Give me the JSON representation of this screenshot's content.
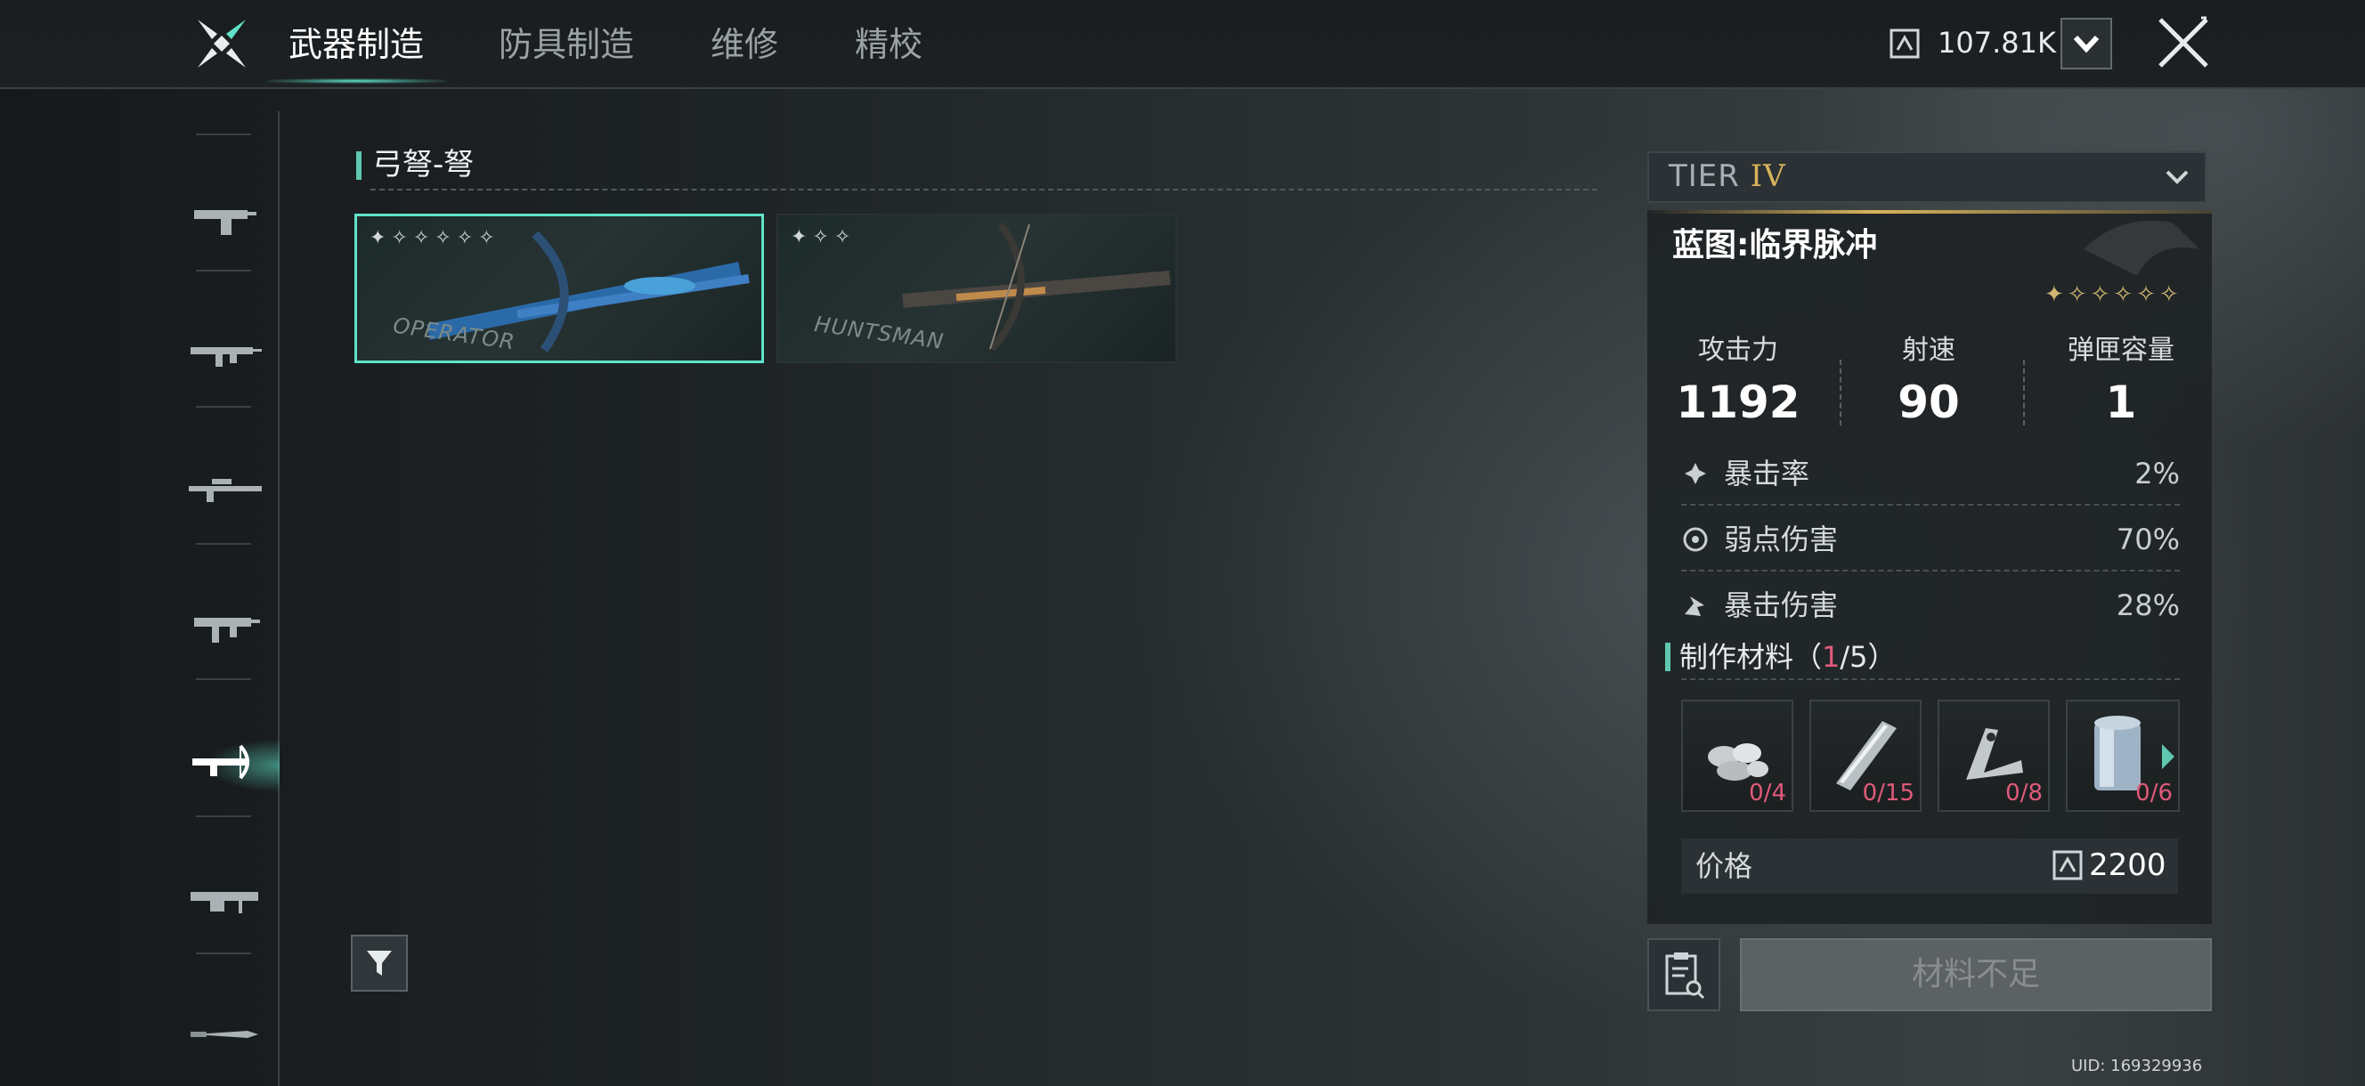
{
  "header": {
    "tabs": [
      {
        "label": "武器制造"
      },
      {
        "label": "防具制造"
      },
      {
        "label": "维修"
      },
      {
        "label": "精校"
      }
    ],
    "currency_amount": "107.81K"
  },
  "sidebar": {
    "categories": [
      {
        "icon": "pistol-icon"
      },
      {
        "icon": "assault-rifle-icon"
      },
      {
        "icon": "sniper-rifle-icon"
      },
      {
        "icon": "smg-icon"
      },
      {
        "icon": "crossbow-icon",
        "active": true
      },
      {
        "icon": "machine-gun-icon"
      },
      {
        "icon": "melee-knife-icon"
      }
    ]
  },
  "catalog": {
    "category_title": "弓弩-弩",
    "items": [
      {
        "name": "OPERATOR",
        "stars": "✦✧✧✧✧✧",
        "selected": true
      },
      {
        "name": "HUNTSMAN",
        "stars": "✦✧✧",
        "selected": false
      }
    ]
  },
  "panel": {
    "tier_label": "TIER",
    "tier_num": "IV",
    "blueprint_name": "蓝图:临界脉冲",
    "stars": "✦✧✧✧✧✧",
    "stats": [
      {
        "label": "攻击力",
        "value": "1192"
      },
      {
        "label": "射速",
        "value": "90"
      },
      {
        "label": "弹匣容量",
        "value": "1"
      }
    ],
    "sub_stats": [
      {
        "label": "暴击率",
        "value": "2%"
      },
      {
        "label": "弱点伤害",
        "value": "70%"
      },
      {
        "label": "暴击伤害",
        "value": "28%"
      }
    ],
    "materials_title": "制作材料（",
    "materials_current": "1",
    "materials_rest": "/5）",
    "materials": [
      {
        "count": "0/4"
      },
      {
        "count": "0/15"
      },
      {
        "count": "0/8"
      },
      {
        "count": "0/6"
      }
    ],
    "price_label": "价格",
    "price_value": "2200",
    "craft_button": "材料不足"
  },
  "footer": {
    "uid": "UID: 169329936"
  },
  "colors": {
    "accent": "#5fe3c9",
    "gold": "#d9b45c",
    "warning": "#e05a7a"
  }
}
